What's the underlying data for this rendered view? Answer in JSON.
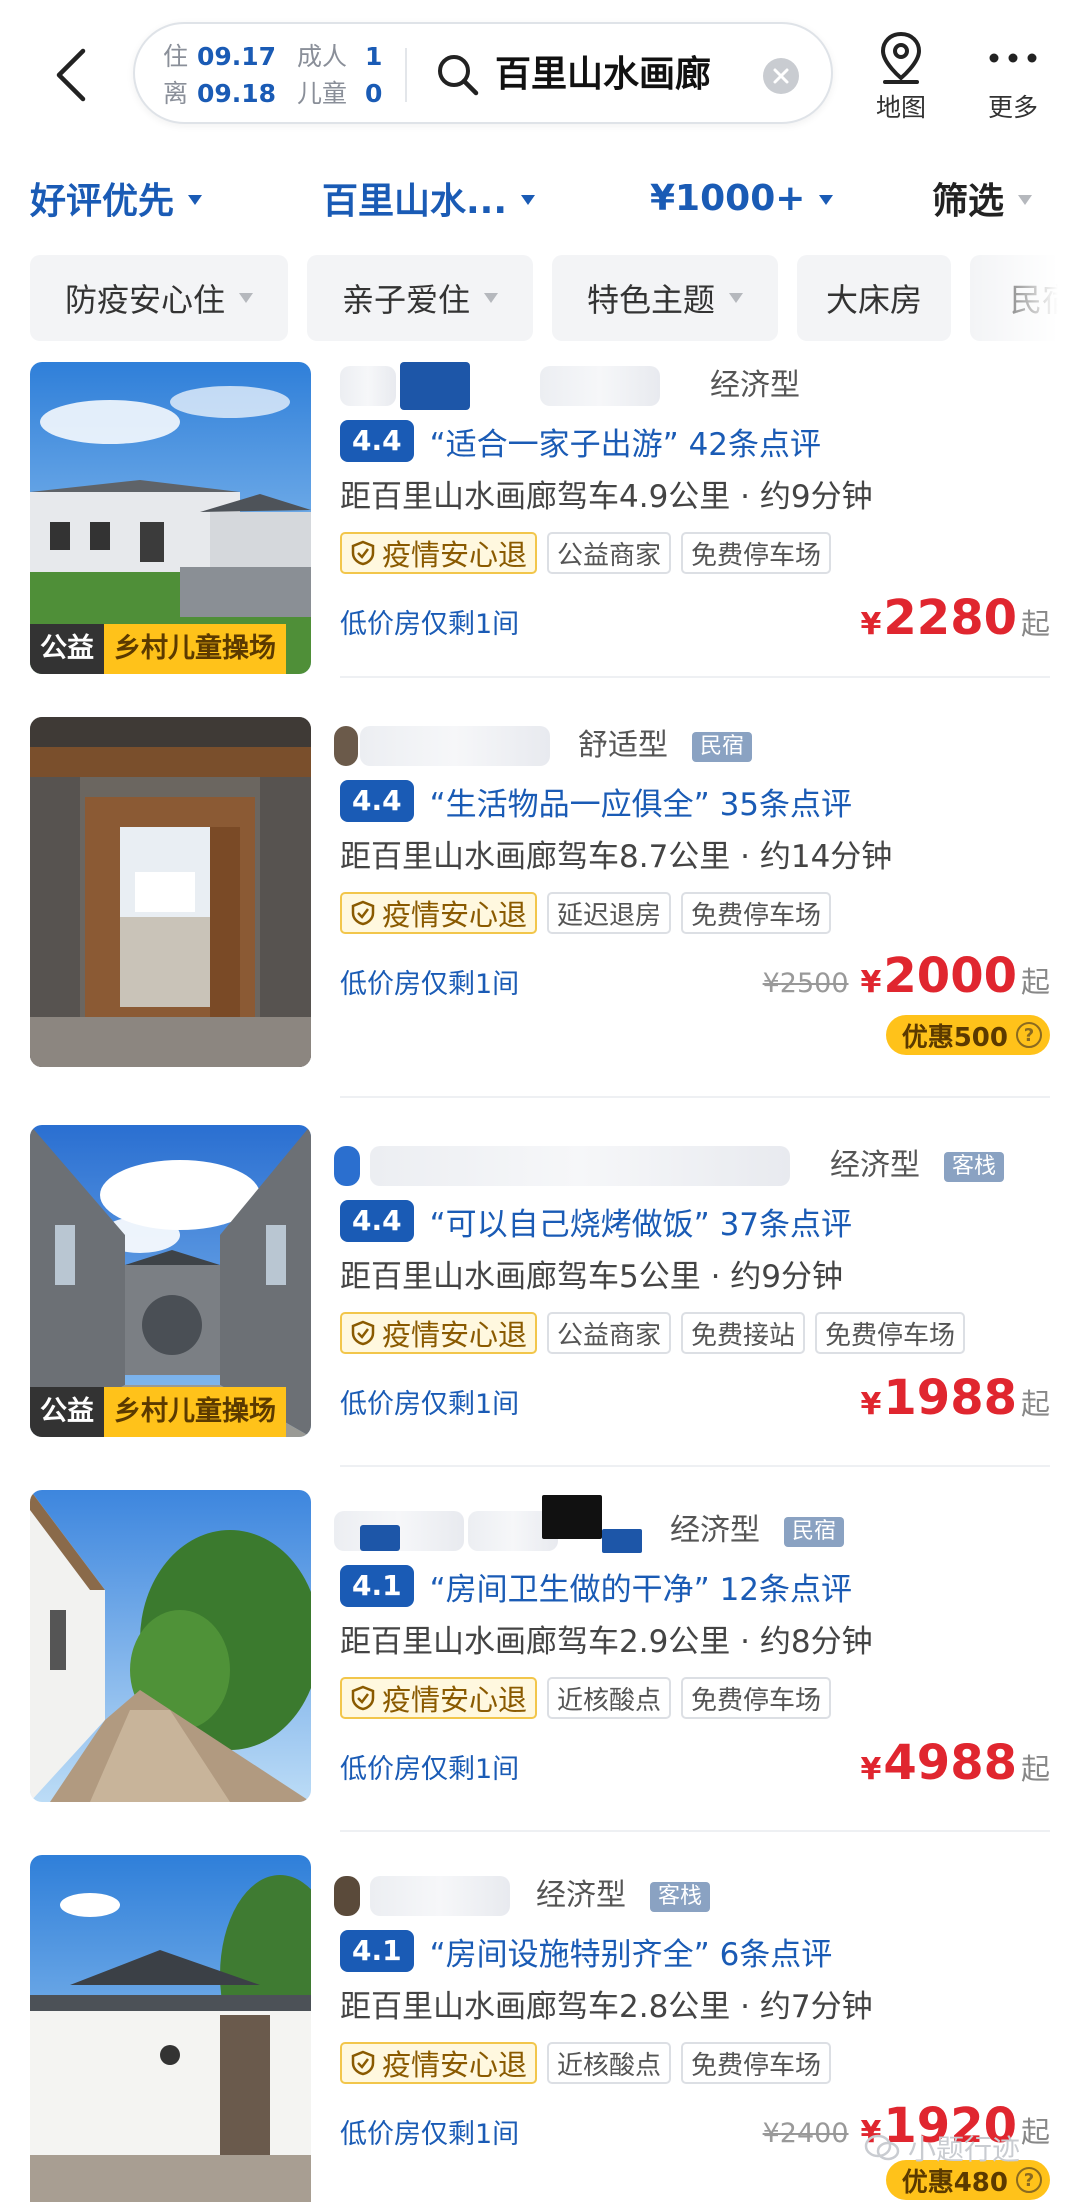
{
  "header": {
    "checkin_label": "住",
    "checkin_date": "09.17",
    "checkout_label": "离",
    "checkout_date": "09.18",
    "adults_label": "成人",
    "adults_count": "1",
    "children_label": "儿童",
    "children_count": "0",
    "search_text": "百里山水画廊",
    "map_label": "地图",
    "more_label": "更多"
  },
  "sortbar": {
    "sort": "好评优先",
    "location": "百里山水...",
    "price": "¥1000+",
    "filter": "筛选"
  },
  "chips": [
    "防疫安心住",
    "亲子爱住",
    "特色主题",
    "大床房",
    "民宿"
  ],
  "listings": [
    {
      "type": "经济型",
      "badge": "",
      "score": "4.4",
      "quote": "“适合一家子出游” 42条点评",
      "distance": "距百里山水画廊驾车4.9公里 · 约9分钟",
      "safe_tag": "疫情安心退",
      "tags": [
        "公益商家",
        "免费停车场"
      ],
      "img_tag1": "公益",
      "img_tag2": "乡村儿童操场",
      "low_stock": "低价房仅剩1间",
      "orig_price": "",
      "currency": "¥",
      "price": "2280",
      "price_suffix": "起",
      "discount": ""
    },
    {
      "type": "舒适型",
      "badge": "民宿",
      "score": "4.4",
      "quote": "“生活物品一应俱全” 35条点评",
      "distance": "距百里山水画廊驾车8.7公里 · 约14分钟",
      "safe_tag": "疫情安心退",
      "tags": [
        "延迟退房",
        "免费停车场"
      ],
      "img_tag1": "",
      "img_tag2": "",
      "low_stock": "低价房仅剩1间",
      "orig_price": "¥2500",
      "currency": "¥",
      "price": "2000",
      "price_suffix": "起",
      "discount": "优惠500"
    },
    {
      "type": "经济型",
      "badge": "客栈",
      "score": "4.4",
      "quote": "“可以自己烧烤做饭” 37条点评",
      "distance": "距百里山水画廊驾车5公里 · 约9分钟",
      "safe_tag": "疫情安心退",
      "tags": [
        "公益商家",
        "免费接站",
        "免费停车场"
      ],
      "img_tag1": "公益",
      "img_tag2": "乡村儿童操场",
      "low_stock": "低价房仅剩1间",
      "orig_price": "",
      "currency": "¥",
      "price": "1988",
      "price_suffix": "起",
      "discount": ""
    },
    {
      "type": "经济型",
      "badge": "民宿",
      "score": "4.1",
      "quote": "“房间卫生做的干净” 12条点评",
      "distance": "距百里山水画廊驾车2.9公里 · 约8分钟",
      "safe_tag": "疫情安心退",
      "tags": [
        "近核酸点",
        "免费停车场"
      ],
      "img_tag1": "",
      "img_tag2": "",
      "low_stock": "低价房仅剩1间",
      "orig_price": "",
      "currency": "¥",
      "price": "4988",
      "price_suffix": "起",
      "discount": ""
    },
    {
      "type": "经济型",
      "badge": "客栈",
      "score": "4.1",
      "quote": "“房间设施特别齐全” 6条点评",
      "distance": "距百里山水画廊驾车2.8公里 · 约7分钟",
      "safe_tag": "疫情安心退",
      "tags": [
        "近核酸点",
        "免费停车场"
      ],
      "img_tag1": "",
      "img_tag2": "",
      "low_stock": "低价房仅剩1间",
      "orig_price": "¥2400",
      "currency": "¥",
      "price": "1920",
      "price_suffix": "起",
      "discount": "优惠480"
    }
  ],
  "watermark": "小题行迹",
  "colors": {
    "accent": "#1a5bb5",
    "price": "#e0262f",
    "promo": "#ffc21a"
  }
}
